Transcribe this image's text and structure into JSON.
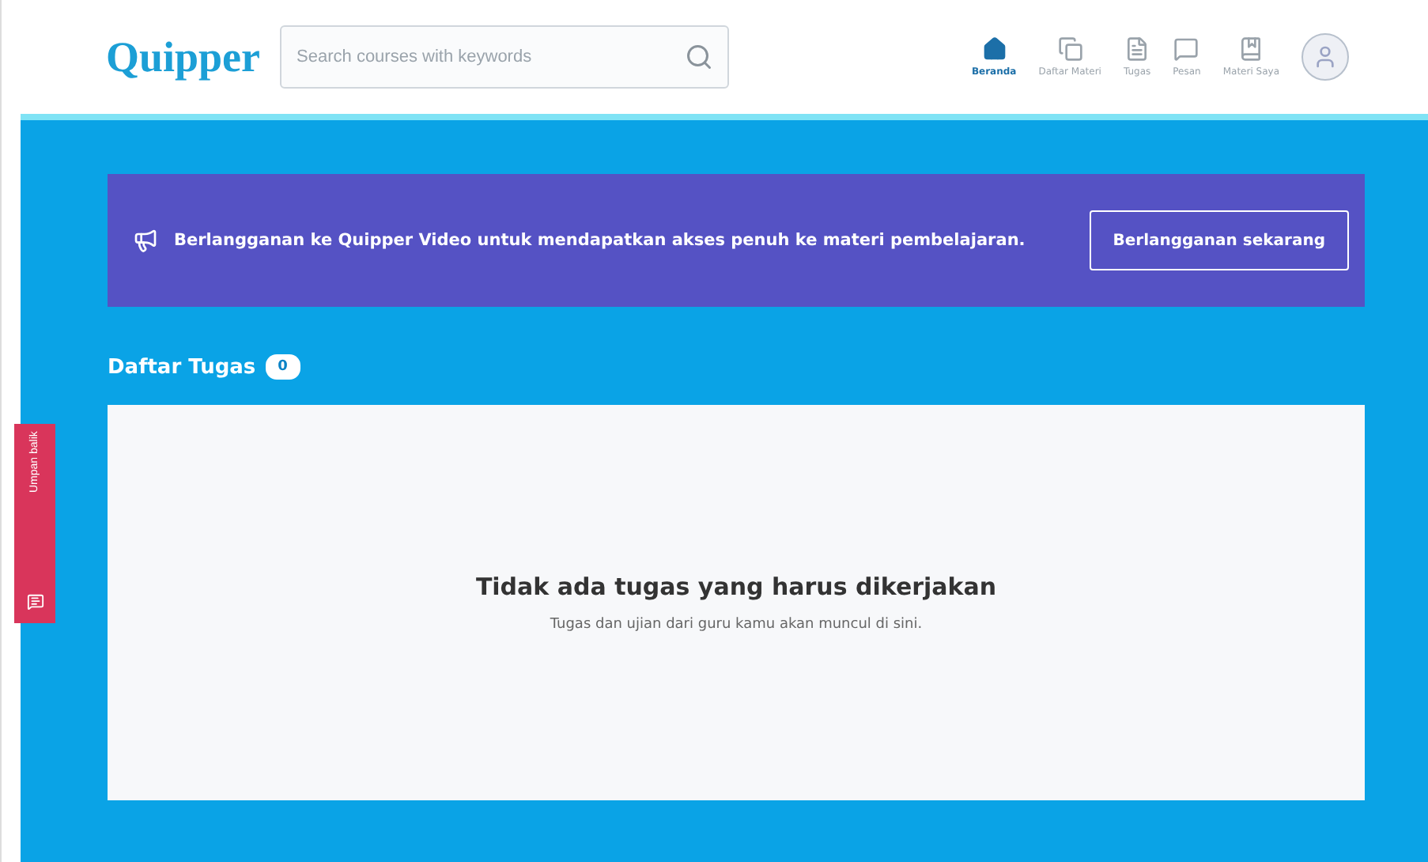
{
  "header": {
    "logo": "Quipper",
    "search": {
      "placeholder": "Search courses with keywords"
    },
    "nav": [
      {
        "label": "Beranda",
        "selected": true
      },
      {
        "label": "Daftar Materi",
        "selected": false
      },
      {
        "label": "Tugas",
        "selected": false
      },
      {
        "label": "Pesan",
        "selected": false
      },
      {
        "label": "Materi Saya",
        "selected": false
      }
    ]
  },
  "banner": {
    "text": "Berlangganan ke Quipper Video untuk mendapatkan akses penuh ke materi pembelajaran.",
    "button": "Berlangganan sekarang"
  },
  "section": {
    "title": "Daftar Tugas",
    "count": "0"
  },
  "empty": {
    "title": "Tidak ada tugas yang harus dikerjakan",
    "subtitle": "Tugas dan ujian dari guru kamu akan muncul di sini."
  },
  "feedback": {
    "label": "Umpan balik"
  }
}
